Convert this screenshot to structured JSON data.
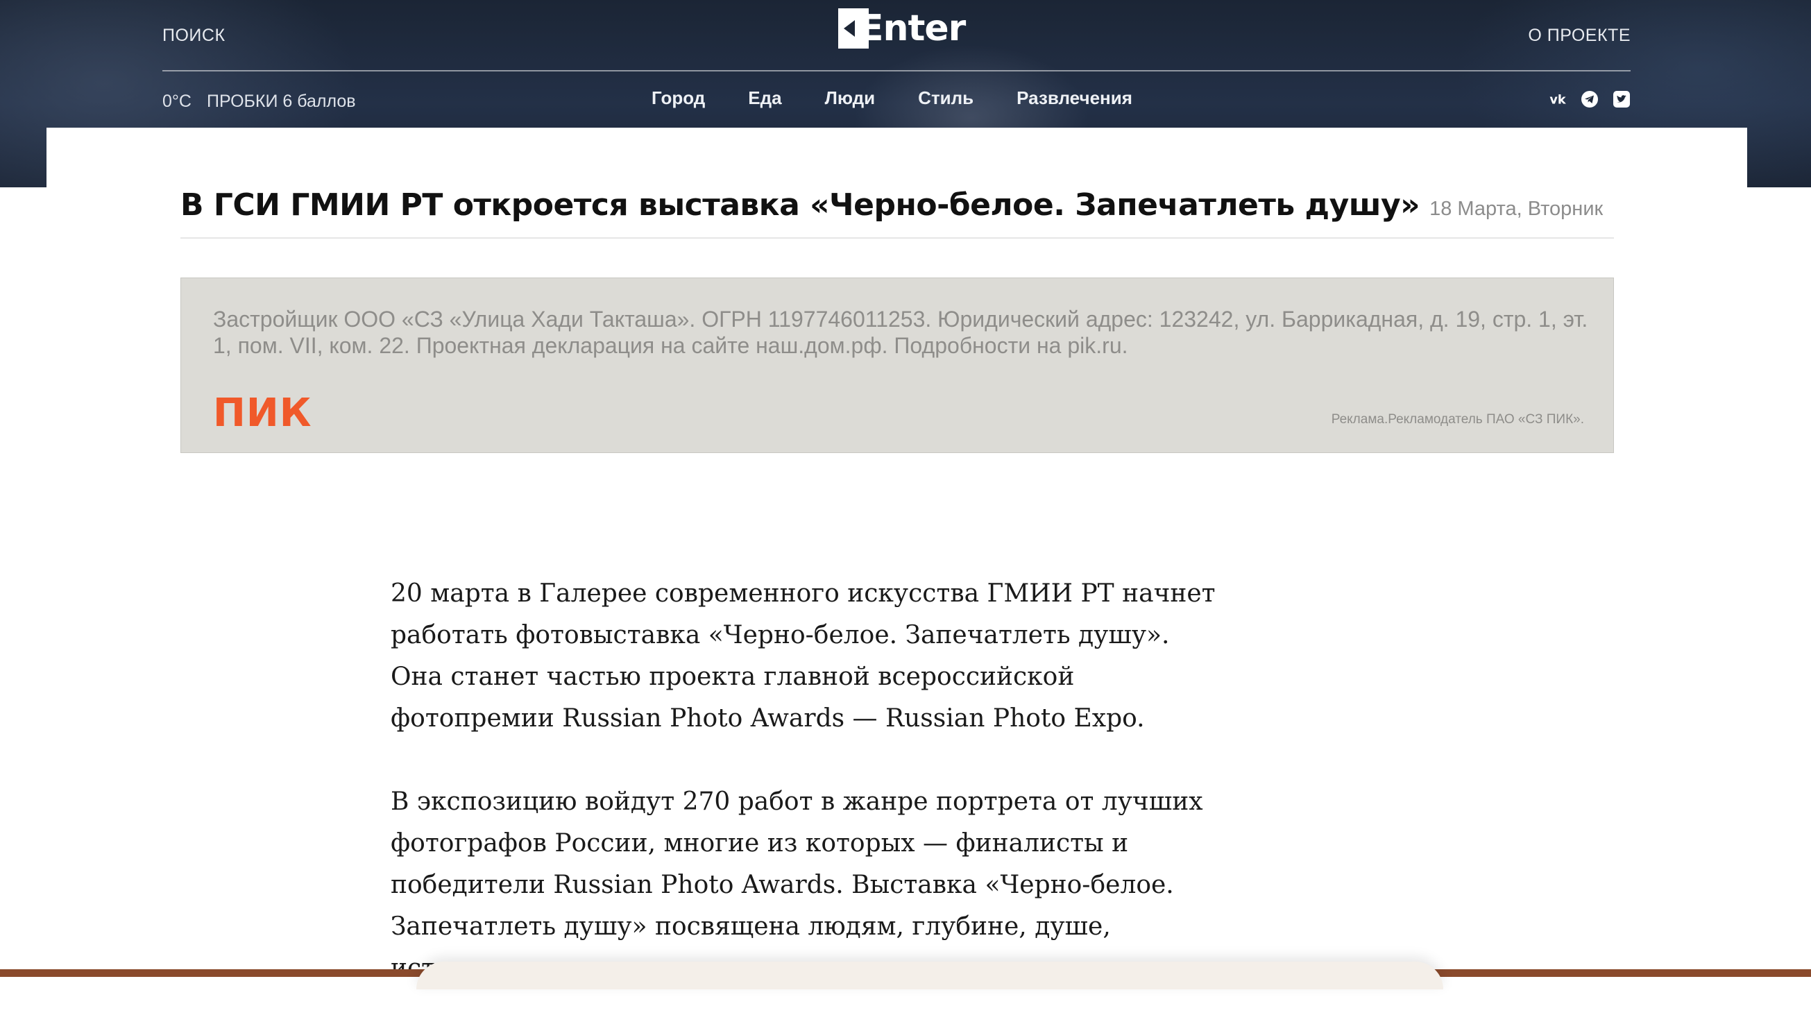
{
  "header": {
    "search_label": "Поиск",
    "about_label": "О проекте",
    "logo_text": "Enter",
    "weather": "0°C",
    "traffic_label": "Пробки",
    "traffic_value": "6 баллов",
    "categories": [
      {
        "label": "Город"
      },
      {
        "label": "Еда"
      },
      {
        "label": "Люди"
      },
      {
        "label": "Стиль"
      },
      {
        "label": "Развлечения"
      }
    ],
    "social": [
      {
        "icon": "vk-icon"
      },
      {
        "icon": "telegram-icon"
      },
      {
        "icon": "twitter-icon"
      }
    ]
  },
  "article": {
    "title": "В ГСИ ГМИИ РТ откроется выставка «Черно-белое. Запечатлеть душу»",
    "date": "18 Марта, Вторник",
    "paragraphs": [
      "20 марта в Галерее современного искусства ГМИИ РТ начнет работать фотовыставка «Черно-белое. Запечатлеть душу». Она станет частью проекта главной всероссийской фотопремии Russian Photo Awards — Russian Photo Expo.",
      "В экспозицию войдут 270 работ в жанре портрета от лучших фотографов России, многие из которых — финалисты и победители Russian Photo Awards. Выставка «Черно-белое. Запечатлеть душу» посвящена людям, глубине, душе, истинным желаниям и стремлениям."
    ]
  },
  "ad": {
    "text": "Застройщик ООО «СЗ «Улица Хади Такташа». ОГРН 1197746011253. Юридический адрес: 123242, ул. Баррикадная, д. 19, стр. 1, эт. 1, пом. VII, ком. 22. Проектная декларация на сайте наш.дом.рф. Подробности на pik.ru.",
    "brand": "ПИК",
    "disclaimer": "Реклама.Рекламодатель ПАО «СЗ ПИК».",
    "brand_color": "#f0592a"
  }
}
